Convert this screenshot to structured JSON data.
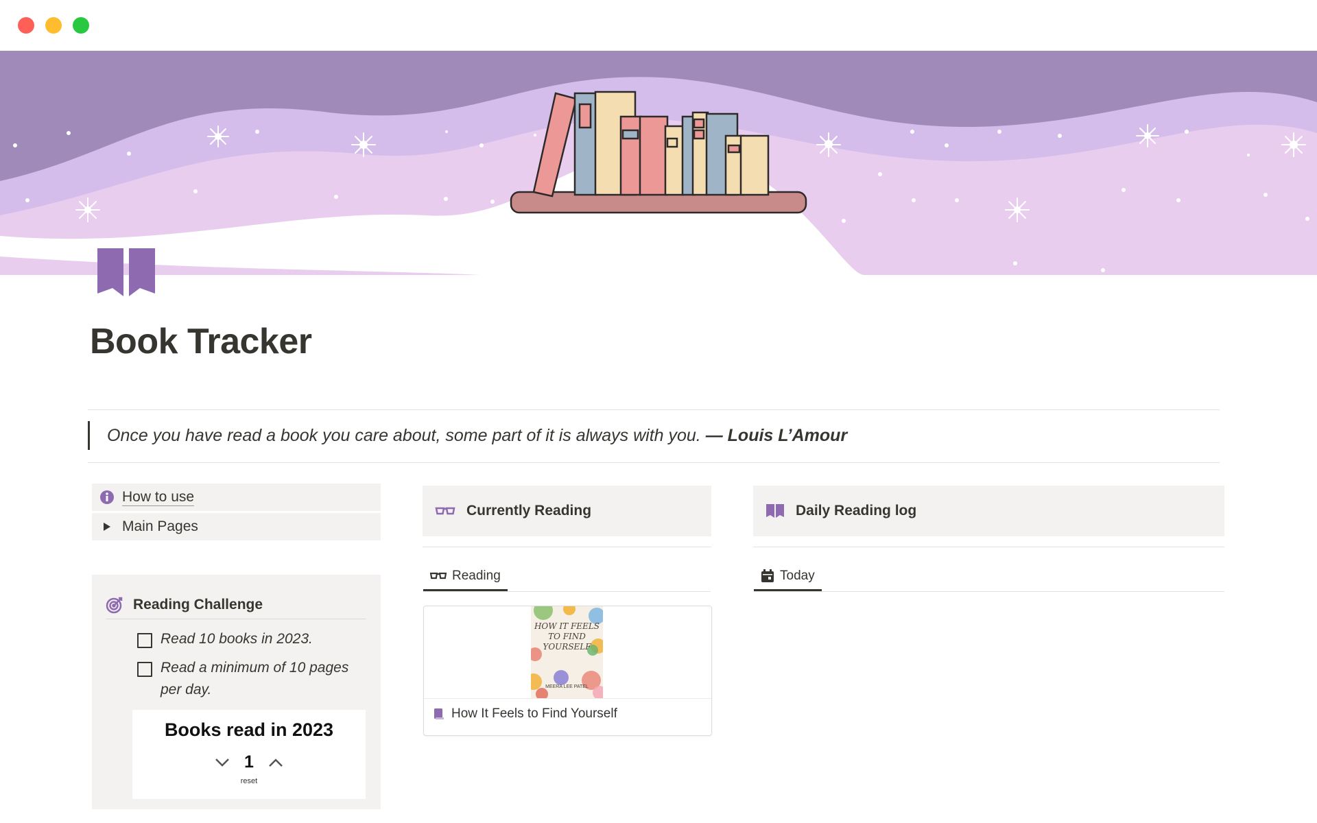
{
  "window": {
    "controls": [
      "close",
      "minimize",
      "maximize"
    ]
  },
  "page": {
    "title": "Book Tracker",
    "icon": "book-icon",
    "cover": "purple-waves-bookshelf-stars"
  },
  "quote": {
    "text": "Once you have read a book you care about, some part of it is always with you.",
    "author": "— Louis L’Amour"
  },
  "sidebar": {
    "items": [
      {
        "label": "How to use",
        "icon": "info-icon"
      },
      {
        "label": "Main Pages",
        "icon": "triangle-right-icon"
      }
    ]
  },
  "challenge": {
    "title": "Reading Challenge",
    "icon": "target-icon",
    "todos": [
      {
        "text": "Read 10 books in 2023.",
        "checked": false
      },
      {
        "text": "Read a minimum of 10 pages per day.",
        "checked": false
      }
    ],
    "counter": {
      "title": "Books read in 2023",
      "value": "1",
      "reset_label": "reset"
    }
  },
  "currently_reading": {
    "heading": "Currently Reading",
    "icon": "glasses-icon",
    "tab": "Reading",
    "cards": [
      {
        "title": "How It Feels to Find Yourself",
        "cover_text": [
          "HOW IT FEELS",
          "TO FIND",
          "YOURSELF"
        ],
        "cover_author": "MEERA LEE PATEL"
      }
    ]
  },
  "daily_log": {
    "heading": "Daily Reading log",
    "icon": "book-icon",
    "tab": "Today",
    "tab_icon": "calendar-icon"
  },
  "colors": {
    "accent": "#8e6bb0",
    "text": "#37352f",
    "panel": "#f3f2f1",
    "cover_bg": "#9f8ab9"
  }
}
